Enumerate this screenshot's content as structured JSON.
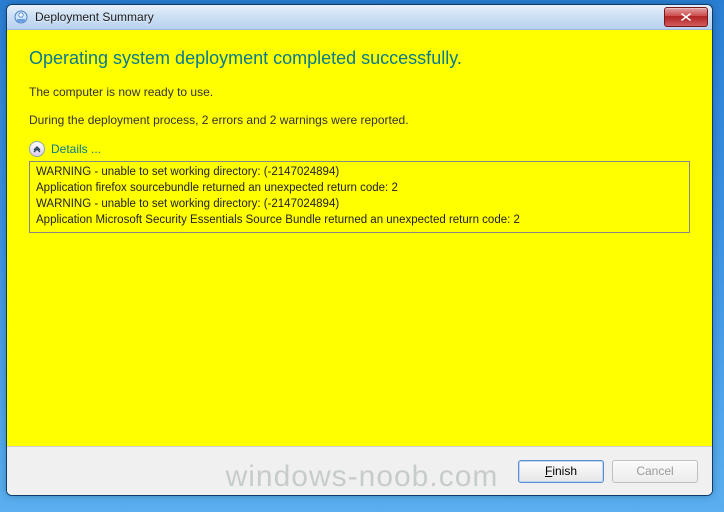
{
  "window": {
    "title": "Deployment Summary"
  },
  "summary": {
    "headline": "Operating system deployment completed successfully.",
    "ready_text": "The computer is now ready to use.",
    "error_report": "During the deployment process, 2 errors and 2 warnings were reported."
  },
  "details": {
    "toggle_label": "Details ...",
    "lines": [
      "WARNING - unable to set working directory:  (-2147024894)",
      "Application firefox sourcebundle returned an unexpected return code: 2",
      "WARNING - unable to set working directory:  (-2147024894)",
      "Application Microsoft Security Essentials Source Bundle returned an unexpected return code: 2"
    ]
  },
  "buttons": {
    "finish": "Finish",
    "cancel": "Cancel"
  },
  "watermark": "windows-noob.com"
}
